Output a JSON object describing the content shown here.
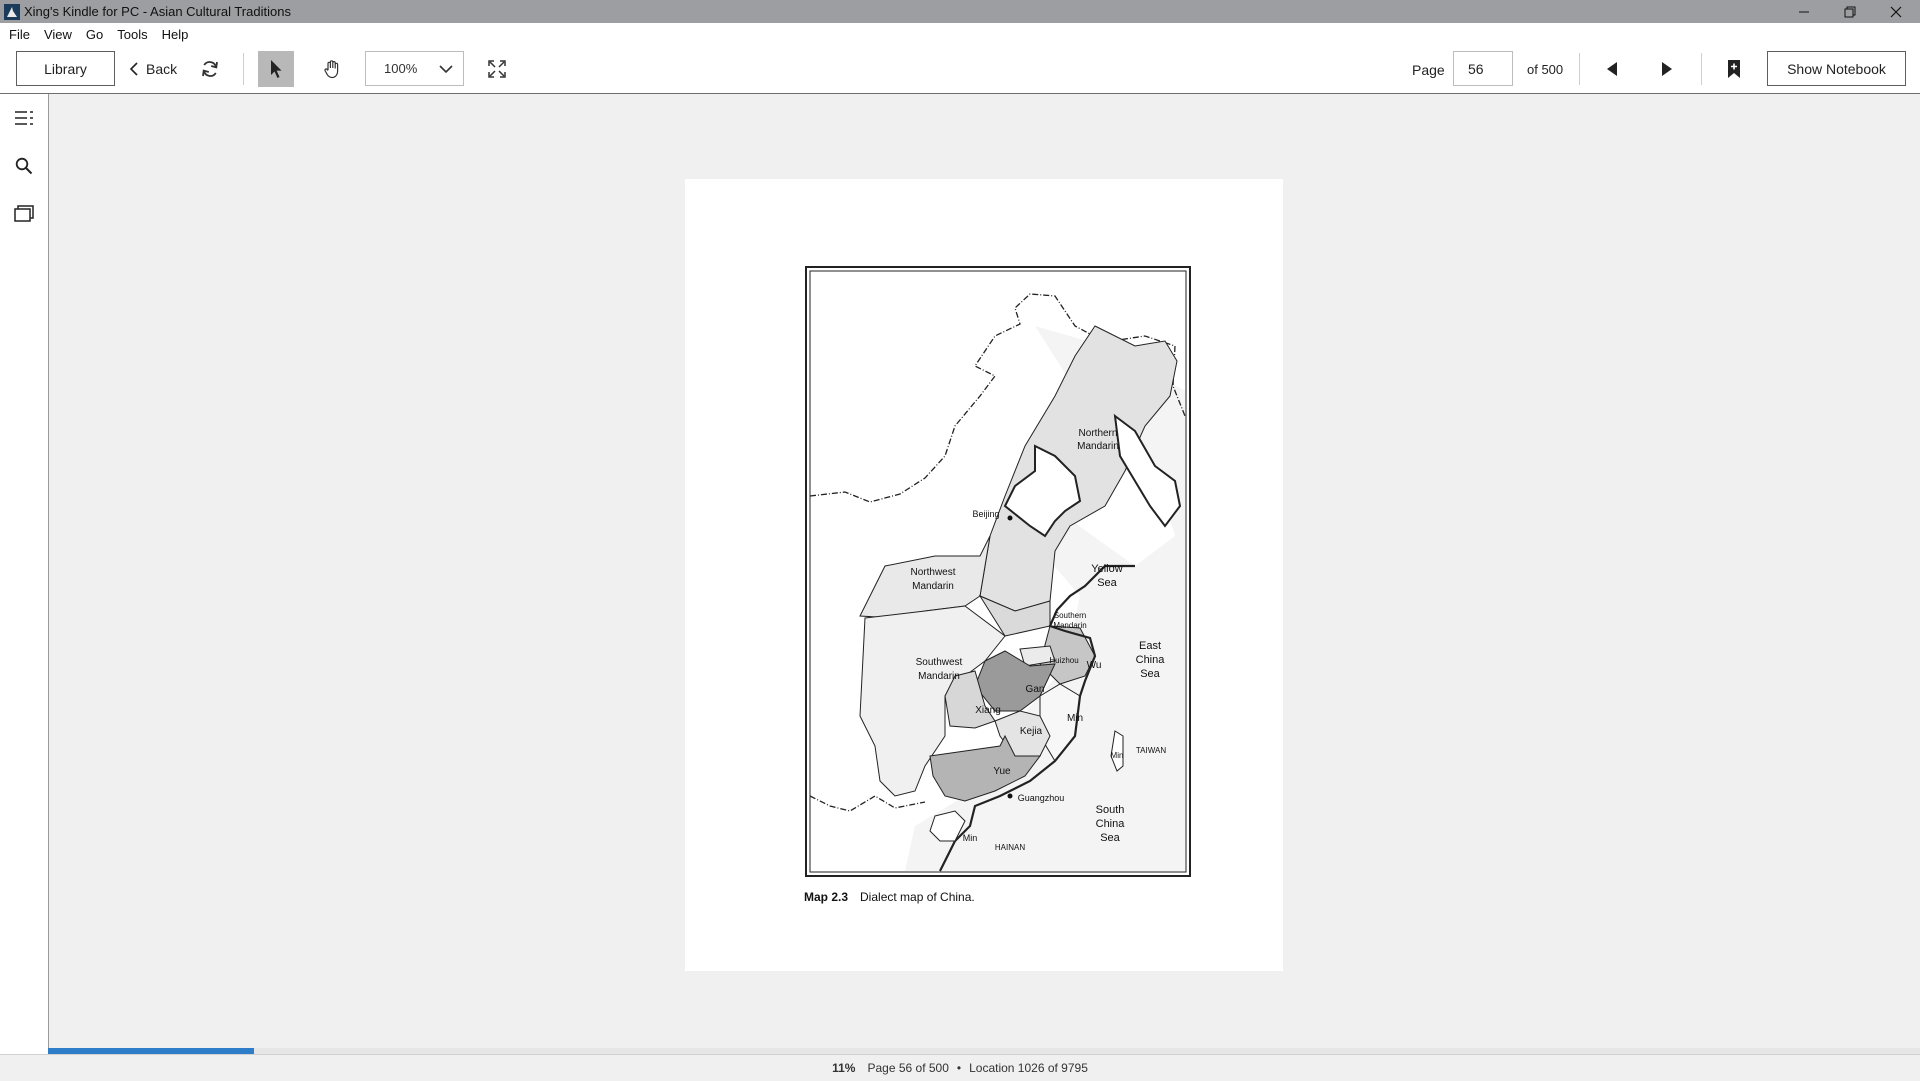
{
  "window": {
    "title": "Xing's Kindle for PC - Asian Cultural Traditions",
    "controls": [
      "minimize",
      "maximize",
      "close"
    ]
  },
  "menu": {
    "items": [
      {
        "label": "File"
      },
      {
        "label": "View"
      },
      {
        "label": "Go"
      },
      {
        "label": "Tools"
      },
      {
        "label": "Help"
      }
    ]
  },
  "toolbar": {
    "library_label": "Library",
    "back_label": "Back",
    "zoom_value": "100%",
    "page_label": "Page",
    "page_value": "56",
    "of_label": "of 500",
    "notebook_label": "Show Notebook"
  },
  "book_page": {
    "map_labels": {
      "northern": [
        "Northern",
        "Mandarin"
      ],
      "northwest": [
        "Northwest",
        "Mandarin"
      ],
      "southwest": [
        "Southwest",
        "Mandarin"
      ],
      "southern": [
        "Southern",
        "Mandarin"
      ],
      "beijing": "Beijing",
      "yellow_sea": [
        "Yellow",
        "Sea"
      ],
      "east_china_sea": [
        "East",
        "China",
        "Sea"
      ],
      "south_china_sea": [
        "South",
        "China",
        "Sea"
      ],
      "huizhou": "Huizhou",
      "wu": "Wu",
      "gan": "Gan",
      "xiang": "Xiang",
      "kejia": "Kejia",
      "min": "Min",
      "min_taiwan": "Min",
      "taiwan": "TAIWAN",
      "yue": "Yue",
      "guangzhou": "Guangzhou",
      "min_hainan": "Min",
      "hainan": "HAINAN"
    },
    "caption_label": "Map 2.3",
    "caption_text": "Dialect map of China."
  },
  "progress": {
    "percent_fraction": 0.11
  },
  "status": {
    "percent": "11%",
    "page_info": "Page 56 of 500",
    "separator": "•",
    "location": "Location 1026 of 9795"
  }
}
